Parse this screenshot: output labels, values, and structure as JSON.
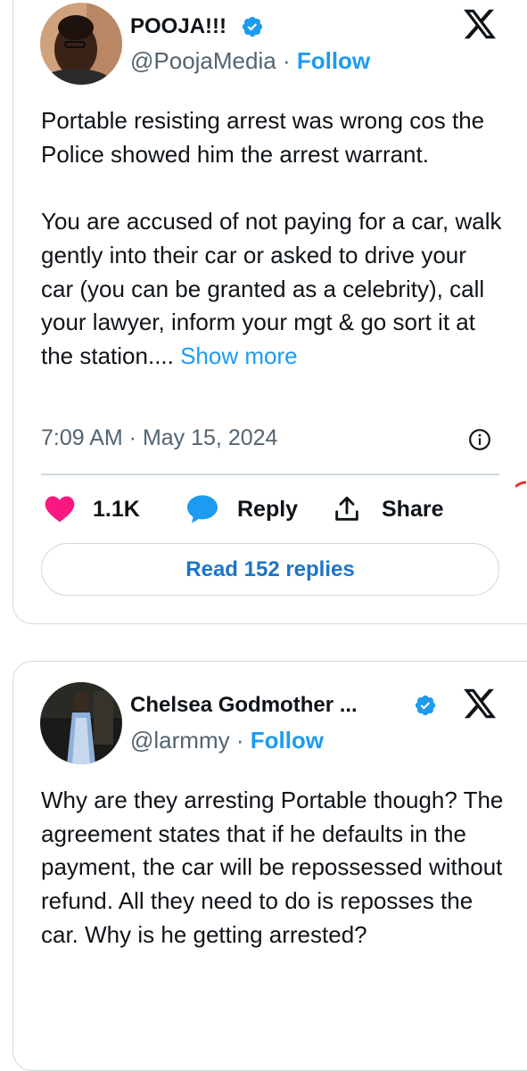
{
  "tweets": [
    {
      "display_name": "POOJA!!!",
      "handle": "@PoojaMedia",
      "separator": " · ",
      "follow_label": "Follow",
      "paragraphs": [
        "Portable resisting arrest was wrong cos the Police showed him the arrest warrant.",
        "You are accused of not paying for a car, walk gently into their car or asked to drive your car (you can be granted as a celebrity), call your lawyer, inform your mgt & go sort it at the station.... "
      ],
      "show_more_label": "Show more",
      "timestamp": "7:09 AM · May 15, 2024",
      "likes_count": "1.1K",
      "reply_label": "Reply",
      "share_label": "Share",
      "read_replies_label": "Read 152 replies"
    },
    {
      "display_name": "Chelsea Godmother ...",
      "handle": "@larmmy",
      "separator": " · ",
      "follow_label": "Follow",
      "paragraphs": [
        "Why are they arresting Portable though? The agreement states that if he defaults in the payment, the car will be repossessed without refund. All they need to do is reposses the car. Why is he getting arrested?"
      ]
    }
  ],
  "colors": {
    "accent": "#1d9bf0",
    "like": "#f91880",
    "text": "#0f1419",
    "secondary": "#536471",
    "border": "#cfd9de"
  },
  "icons": [
    "verified-badge-icon",
    "x-logo-icon",
    "info-icon",
    "heart-icon",
    "reply-bubble-icon",
    "share-icon"
  ]
}
